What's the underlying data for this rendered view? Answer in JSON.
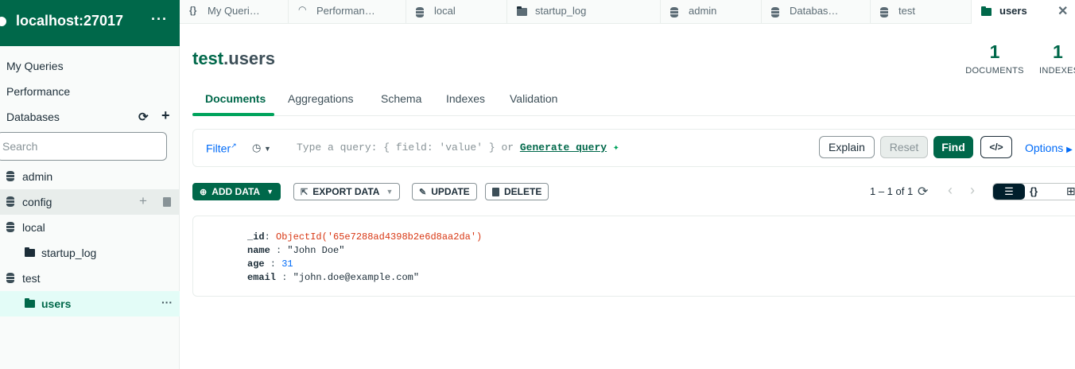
{
  "connection": {
    "title": "localhost:27017",
    "more": "···"
  },
  "sidebar": {
    "nav": [
      "My Queries",
      "Performance",
      "Databases"
    ],
    "search_placeholder": "Search",
    "tree": [
      {
        "label": "admin",
        "kind": "database"
      },
      {
        "label": "config",
        "kind": "database"
      },
      {
        "label": "local",
        "kind": "database"
      },
      {
        "label": "startup_log",
        "kind": "collection"
      },
      {
        "label": "test",
        "kind": "database"
      },
      {
        "label": "users",
        "kind": "collection"
      }
    ]
  },
  "tabs": [
    {
      "icon": "{}",
      "label": "My Queri…"
    },
    {
      "icon": "performance-icon",
      "label": "Performan…"
    },
    {
      "icon": "database-icon",
      "label": "local"
    },
    {
      "icon": "folder-icon",
      "label": "startup_log"
    },
    {
      "icon": "database-icon",
      "label": "admin"
    },
    {
      "icon": "database-icon",
      "label": "Databas…"
    },
    {
      "icon": "database-icon",
      "label": "test"
    },
    {
      "icon": "folder-icon",
      "label": "users",
      "active": true
    }
  ],
  "header": {
    "db": "test",
    "dot": ".",
    "collection": "users",
    "stats": [
      {
        "value": "1",
        "label": "DOCUMENTS"
      },
      {
        "value": "1",
        "label": "INDEXES"
      }
    ]
  },
  "subtabs": [
    "Documents",
    "Aggregations",
    "Schema",
    "Indexes",
    "Validation"
  ],
  "query": {
    "filter_label": "Filter",
    "placeholder": "Type a query: { field: 'value' } or",
    "generate": "Generate query",
    "explain": "Explain",
    "reset": "Reset",
    "find": "Find",
    "code": "</>",
    "options": "Options"
  },
  "toolbar": {
    "add_data": "ADD DATA",
    "export_data": "EXPORT DATA",
    "update": "UPDATE",
    "delete": "DELETE",
    "pagination": "1 – 1 of 1",
    "json_view": "{}"
  },
  "document": {
    "fields": [
      {
        "key": "_id",
        "value": "ObjectId('65e7288ad4398b2e6d8aa2da')",
        "type": "objectid"
      },
      {
        "key": "name",
        "value": "\"John Doe\"",
        "type": "string"
      },
      {
        "key": "age",
        "value": "31",
        "type": "number"
      },
      {
        "key": "email",
        "value": "\"john.doe@example.com\"",
        "type": "string"
      }
    ]
  },
  "colors": {
    "brand": "#00684a",
    "accent": "#00a35c",
    "link": "#016bf8",
    "objectid": "#d83713",
    "number": "#016bf8"
  }
}
